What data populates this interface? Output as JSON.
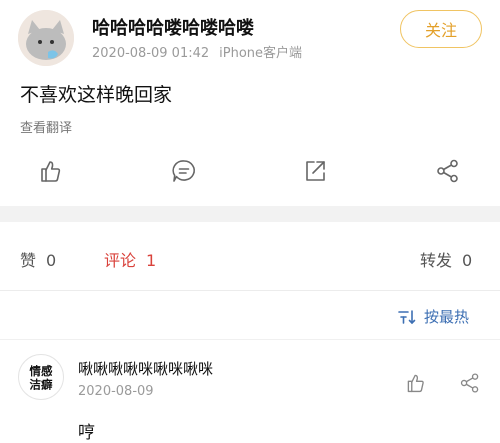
{
  "post": {
    "username": "哈哈哈哈喽哈喽哈喽",
    "date": "2020-08-09 01:42",
    "device": "iPhone客户端",
    "follow_label": "关注",
    "text": "不喜欢这样晚回家",
    "translate_label": "查看翻译"
  },
  "stats": {
    "likes_label": "赞",
    "likes_count": "0",
    "comments_label": "评论",
    "comments_count": "1",
    "reposts_label": "转发",
    "reposts_count": "0"
  },
  "sort": {
    "label": "按最热"
  },
  "comment": {
    "username": "啾啾啾啾咪啾咪啾咪",
    "date": "2020-08-09",
    "text": "哼",
    "avatar_text": "情感洁癖"
  },
  "colors": {
    "accent_active": "#d9423b",
    "follow": "#e3a02a",
    "sort_link": "#3d6fb3"
  }
}
